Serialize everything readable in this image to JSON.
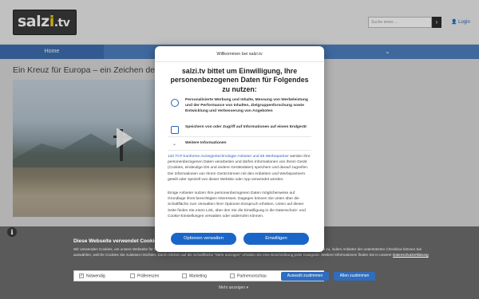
{
  "site": {
    "logo_main": "salz",
    "logo_accent": "i",
    "logo_tail": ".tv",
    "search_placeholder": "Suche eines ...",
    "search_button": "›",
    "login": "👤 Login",
    "nav_home": "Home",
    "nav_chevron": "⌄",
    "article_title": "Ein Kreuz für Europa – ein Zeichen der Ein"
  },
  "modal": {
    "header": "Willkommen bei salzi.tv",
    "title": "salzi.tv bittet um Einwilligung, Ihre personenbezogenen Daten für Folgendes zu nutzen:",
    "purposes": [
      {
        "icon": "person-icon",
        "text": "Personalisierte Werbung und Inhalte, Messung von Werbeleistung und der Performance von Inhalten, Zielgruppenforschung sowie Entwicklung und Verbesserung von Angeboten"
      },
      {
        "icon": "device-icon",
        "text": "Speichern von oder Zugriff auf Informationen auf einem Endgerät"
      },
      {
        "icon": "chevron-down-icon",
        "text": "Weitere Informationen"
      }
    ],
    "partners_link": "132 TCF-konforme Anzeigentechnologie-Anbieter und 65 Werbepartner",
    "body1": " werden Ihre personenbezogenen Daten verarbeiten und dürfen Informationen von Ihrem Gerät (Cookies, eindeutige IDs und andere Gerätedaten) speichern und darauf zugreifen. Die Informationen von Ihrem Gerät können mit den Anbietern und Werbepartnern geteilt oder speziell von dieser Website oder App verwendet werden.",
    "body2": "Einige Anbieter nutzen Ihre personenbezogenen Daten möglicherweise auf Grundlage ihres berechtigten Interesses. Dagegen können Sie unten über die Schaltfläche zum Verwalten Ihrer Optionen Einspruch erheben. Unten auf dieser Seite finden Sie einen Link, über den Sie die Einwilligung in die Datenschutz- und Cookie-Einstellungen verwalten oder widerrufen können.",
    "btn_manage": "Optionen verwalten",
    "btn_accept": "Einwilligen"
  },
  "cookie_bar": {
    "info": "i",
    "title": "Diese Webseite verwendet Cookies",
    "text": "Wir verwenden Cookies, um unsere Webseite für Sie optimal zu gestalten und fortlaufend verbessern zu können. Sie können der Verwendung von Cookies zu, indem Anbieter der unterstützten Checkbox können Sie auswählen, welche Cookies Sie zulassen möchten. Durch Klicken auf die Schaltfläche \"Mehr anzeigen\" erhalten Sie eine Beschreibung jeder Kategorie. Weitere Informationen finden Sie in unserer",
    "link": "Datenschutzerklärung",
    "checks": [
      {
        "label": "Notwendig",
        "checked": true
      },
      {
        "label": "Präferenzen",
        "checked": false
      },
      {
        "label": "Marketing",
        "checked": false
      },
      {
        "label": "Partnervorschau",
        "checked": false
      }
    ],
    "btn_selection": "Auswahl zustimmen",
    "btn_all": "Allen zustimmen",
    "more": "Mehr anzeigen ▾"
  }
}
